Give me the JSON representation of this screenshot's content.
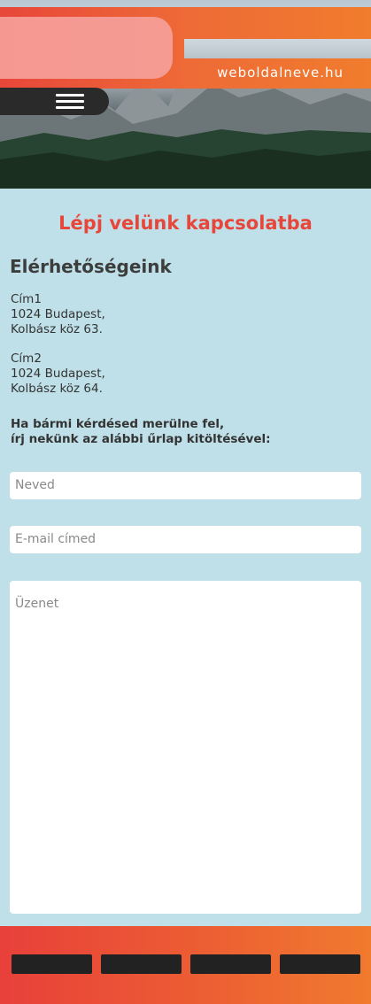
{
  "header": {
    "site_title": "weboldalneve.hu",
    "menu_icon": "hamburger-menu-icon"
  },
  "main": {
    "title": "Lépj velünk kapcsolatba",
    "contacts_heading": "Elérhetőségeink",
    "addresses": [
      {
        "label": "Cím1",
        "line1": "1024 Budapest,",
        "line2": "Kolbász köz 63."
      },
      {
        "label": "Cím2",
        "line1": "1024 Budapest,",
        "line2": "Kolbász köz 64."
      }
    ],
    "question_line1": "Ha bármi kérdésed merülne fel,",
    "question_line2": "írj nekünk az alábbi űrlap kitöltésével:"
  },
  "form": {
    "name_placeholder": "Neved",
    "email_placeholder": "E-mail címed",
    "message_placeholder": "Üzenet"
  },
  "colors": {
    "accent": "#e8463a",
    "background": "#bfe0e8",
    "footer_gradient_start": "#e8403a",
    "footer_gradient_end": "#f07a2e"
  }
}
